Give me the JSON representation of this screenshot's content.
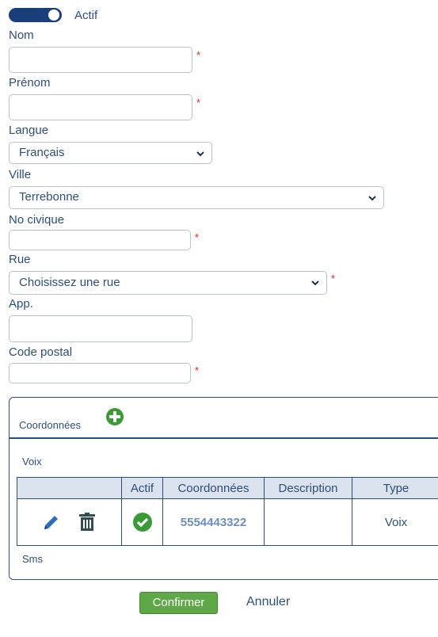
{
  "active_toggle": {
    "label": "Actif",
    "on": true
  },
  "fields": {
    "nom": {
      "label": "Nom",
      "value": "",
      "required_mark": "*"
    },
    "prenom": {
      "label": "Prénom",
      "value": "",
      "required_mark": "*"
    },
    "langue": {
      "label": "Langue",
      "selected": "Français"
    },
    "ville": {
      "label": "Ville",
      "selected": "Terrebonne"
    },
    "no_civique": {
      "label": "No civique",
      "value": "",
      "required_mark": "*"
    },
    "rue": {
      "label": "Rue",
      "selected": "Choisissez une rue",
      "required_mark": "*"
    },
    "app": {
      "label": "App.",
      "value": ""
    },
    "code_postal": {
      "label": "Code postal",
      "value": "",
      "required_mark": "*"
    }
  },
  "coordonnees": {
    "title": "Coordonnées",
    "voix_section": "Voix",
    "sms_section": "Sms",
    "table": {
      "headers": [
        "",
        "Actif",
        "Coordonnées",
        "Description",
        "Type"
      ],
      "rows": [
        {
          "actif": true,
          "coordonnee": "5554443322",
          "description": "",
          "type": "Voix"
        }
      ]
    }
  },
  "actions": {
    "confirm": "Confirmer",
    "cancel": "Annuler"
  },
  "colors": {
    "text": "#2d4f7c",
    "accent_green": "#5fa848",
    "required": "#e02020",
    "toggle": "#1a3e7a"
  }
}
